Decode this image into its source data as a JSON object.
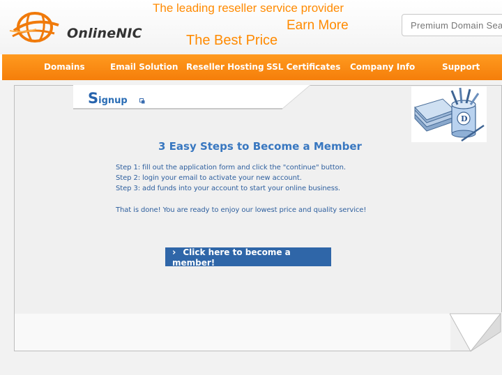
{
  "header": {
    "logo_text": "OnlineNIC",
    "slogans": [
      "The leading reseller service provider",
      "Earn More",
      "The Best Price"
    ],
    "search_placeholder": "Premium Domain Search"
  },
  "nav": {
    "items": [
      {
        "label": "Domains"
      },
      {
        "label": "Email Solution"
      },
      {
        "label": "Reseller Hosting"
      },
      {
        "label": "SSL Certificates"
      },
      {
        "label": "Company Info"
      },
      {
        "label": "Support"
      }
    ]
  },
  "signup": {
    "first_letter": "S",
    "rest": "ignup"
  },
  "main": {
    "title": "3 Easy Steps to Become a Member",
    "steps": [
      "Step 1: fill out the application form and click the \"continue\" button.",
      "Step 2: login your email to activate your new account.",
      "Step 3: add funds into your account to start your online business."
    ],
    "done_text": "That is done! You are ready to enjoy our lowest price and quality service!",
    "cta_label": "Click here to become a member!"
  },
  "colors": {
    "brand_orange": "#f57e0a",
    "link_blue": "#2f66a8",
    "text_blue": "#2e5f9e"
  }
}
